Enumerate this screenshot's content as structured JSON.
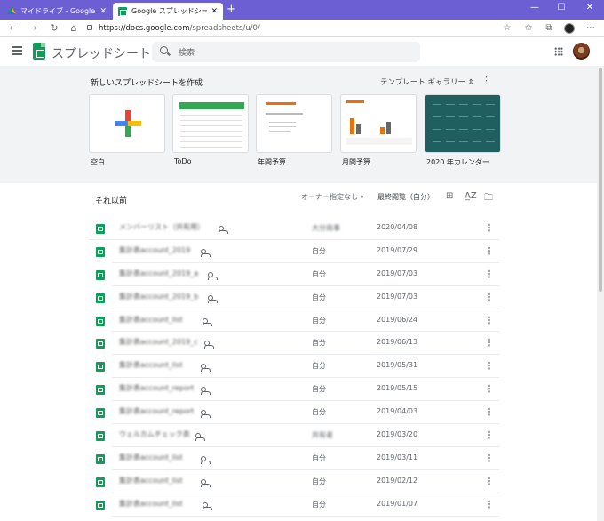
{
  "browser": {
    "tabs": [
      {
        "title": "マイドライブ - Google ドライブ",
        "active": false,
        "favicon": "drive-icon"
      },
      {
        "title": "Google スプレッドシート",
        "active": true,
        "favicon": "sheets-icon"
      }
    ],
    "new_tab": "+",
    "url_host": "https://docs.google.com",
    "url_path": "/spreadsheets/u/0/",
    "window_controls": [
      "—",
      "☐",
      "✕"
    ]
  },
  "app": {
    "name": "スプレッドシート",
    "search_placeholder": "検索"
  },
  "gallery": {
    "heading": "新しいスプレッドシートを作成",
    "gallery_button": "テンプレート ギャラリー",
    "templates": [
      {
        "label": "空白"
      },
      {
        "label": "ToDo"
      },
      {
        "label": "年間予算"
      },
      {
        "label": "月間予算"
      },
      {
        "label": "2020 年カレンダー"
      }
    ]
  },
  "list": {
    "section_title": "それ以前",
    "owner_filter": "オーナー指定なし",
    "sort_label": "最終閲覧（自分）",
    "rows": [
      {
        "name": "メンバーリスト（共有用）",
        "owner": "大分商事",
        "owner_blurred": true,
        "date": "2020/04/08",
        "shared": true
      },
      {
        "name": "集計表account_2019",
        "owner": "自分",
        "owner_blurred": false,
        "date": "2019/07/29",
        "shared": true
      },
      {
        "name": "集計表account_2019_a",
        "owner": "自分",
        "owner_blurred": false,
        "date": "2019/07/03",
        "shared": true
      },
      {
        "name": "集計表account_2019_b",
        "owner": "自分",
        "owner_blurred": false,
        "date": "2019/07/03",
        "shared": true
      },
      {
        "name": "集計表account_list",
        "owner": "自分",
        "owner_blurred": false,
        "date": "2019/06/24",
        "shared": true
      },
      {
        "name": "集計表account_2019_c",
        "owner": "自分",
        "owner_blurred": false,
        "date": "2019/06/13",
        "shared": true
      },
      {
        "name": "集計表account_list",
        "owner": "自分",
        "owner_blurred": false,
        "date": "2019/05/31",
        "shared": true
      },
      {
        "name": "集計表account_report",
        "owner": "自分",
        "owner_blurred": false,
        "date": "2019/05/15",
        "shared": true
      },
      {
        "name": "集計表account_report",
        "owner": "自分",
        "owner_blurred": false,
        "date": "2019/04/03",
        "shared": true
      },
      {
        "name": "ウェルカムチェック表",
        "owner": "共有者",
        "owner_blurred": true,
        "date": "2019/03/20",
        "shared": true
      },
      {
        "name": "集計表account_list",
        "owner": "自分",
        "owner_blurred": false,
        "date": "2019/03/11",
        "shared": true
      },
      {
        "name": "集計表account_list",
        "owner": "自分",
        "owner_blurred": false,
        "date": "2019/02/12",
        "shared": true
      },
      {
        "name": "集計表account_list",
        "owner": "自分",
        "owner_blurred": false,
        "date": "2019/01/07",
        "shared": true
      }
    ]
  },
  "colors": {
    "titlebar": "#6b5fd3",
    "sheets_green": "#0f9d58",
    "gallery_bg": "#f1f3f4"
  }
}
